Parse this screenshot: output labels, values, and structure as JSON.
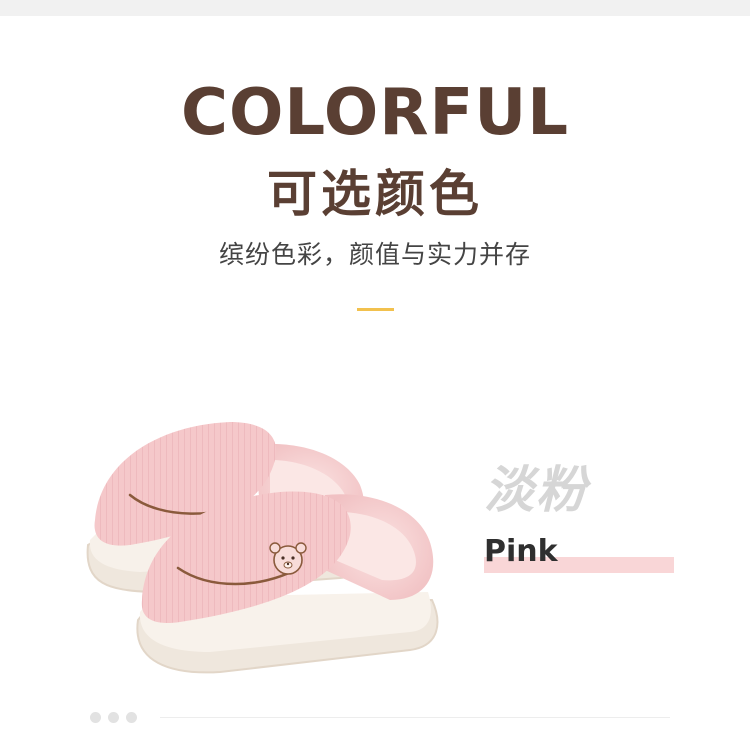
{
  "header": {
    "title": "COLORFUL",
    "subtitle": "可选颜色",
    "tagline": "缤纷色彩，颜值与实力并存"
  },
  "color_option": {
    "name_cn": "淡粉",
    "name_en": "Pink"
  },
  "pagination": {
    "dots": 3
  },
  "colors": {
    "heading_brown": "#5a3f33",
    "accent_yellow": "#f2c14e",
    "slipper_pink": "#f4c6c8",
    "highlight_pink": "#f9d6d7",
    "sole_cream": "#f3ece3"
  },
  "icons": {
    "product": "pink-bear-slippers-image",
    "pagination": "dot-icon"
  }
}
